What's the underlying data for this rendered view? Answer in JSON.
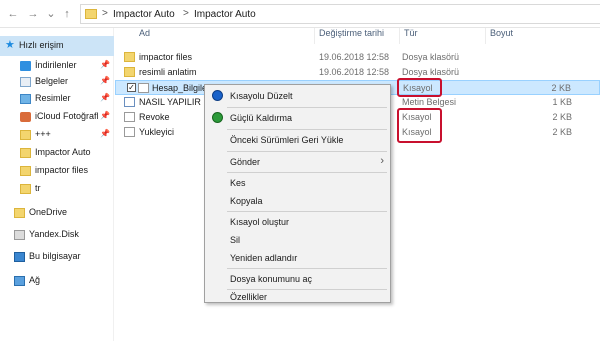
{
  "nav_buttons": {
    "back": "←",
    "forward": "→",
    "recent": "⌄",
    "up": "↑"
  },
  "breadcrumb": [
    "Impactor Auto",
    "Impactor Auto"
  ],
  "breadcrumb_sep": ">",
  "sidebar": {
    "items": [
      {
        "label": "Hızlı erişim",
        "icon": "star-icon",
        "pinned": false
      },
      {
        "label": "İndirilenler",
        "icon": "download-icon",
        "pinned": true
      },
      {
        "label": "Belgeler",
        "icon": "documents-icon",
        "pinned": true
      },
      {
        "label": "Resimler",
        "icon": "pictures-icon",
        "pinned": true
      },
      {
        "label": "iCloud Fotoğrafl",
        "icon": "icloud-icon",
        "pinned": true
      },
      {
        "label": "+++",
        "icon": "folder-icon",
        "pinned": true
      },
      {
        "label": "Impactor Auto",
        "icon": "folder-icon",
        "pinned": false
      },
      {
        "label": "impactor files",
        "icon": "folder-icon",
        "pinned": false
      },
      {
        "label": "tr",
        "icon": "folder-icon",
        "pinned": false
      },
      {
        "label": "OneDrive",
        "icon": "onedrive-icon",
        "pinned": false
      },
      {
        "label": "Yandex.Disk",
        "icon": "yandex-disk-icon",
        "pinned": false
      },
      {
        "label": "Bu bilgisayar",
        "icon": "computer-icon",
        "pinned": false
      },
      {
        "label": "Ağ",
        "icon": "network-icon",
        "pinned": false
      }
    ],
    "pin_glyph": "📌"
  },
  "columns": {
    "name": "Ad",
    "date": "Değiştirme tarihi",
    "type": "Tür",
    "size": "Boyut"
  },
  "files": [
    {
      "name": "impactor files",
      "date": "19.06.2018 12:58",
      "type": "Dosya klasörü",
      "size": "",
      "icon": "folder-icon"
    },
    {
      "name": "resimli anlatim",
      "date": "19.06.2018 12:58",
      "type": "Dosya klasörü",
      "size": "",
      "icon": "folder-icon"
    },
    {
      "name": "Hesap_Bilgiler",
      "date": "",
      "type": "Kısayol",
      "size": "2 KB",
      "icon": "shortcut-icon"
    },
    {
      "name": "NASIL YAPILIR",
      "date": "",
      "type": "Metin Belgesi",
      "size": "1 KB",
      "icon": "text-document-icon"
    },
    {
      "name": "Revoke",
      "date": "",
      "type": "Kısayol",
      "size": "2 KB",
      "icon": "shortcut-icon"
    },
    {
      "name": "Yukleyici",
      "date": "",
      "type": "Kısayol",
      "size": "2 KB",
      "icon": "shortcut-icon"
    }
  ],
  "checkbox_mark": "✓",
  "context_menu": {
    "items": [
      {
        "label": "Kısayolu Düzelt",
        "icon": "fix-shortcut-icon"
      },
      {
        "label": "Güçlü Kaldırma",
        "icon": "uninstall-icon"
      },
      {
        "label": "Önceki Sürümleri Geri Yükle"
      },
      {
        "label": "Gönder",
        "submenu_arrow": "›"
      },
      {
        "label": "Kes"
      },
      {
        "label": "Kopyala"
      },
      {
        "label": "Kısayol oluştur"
      },
      {
        "label": "Sil"
      },
      {
        "label": "Yeniden adlandır"
      },
      {
        "label": "Dosya konumunu aç"
      },
      {
        "label": "Özellikler"
      }
    ]
  },
  "colors": {
    "highlight_box": "#c8102e",
    "selection": "#cce8ff",
    "sidebar_selected": "#cce4f7"
  }
}
